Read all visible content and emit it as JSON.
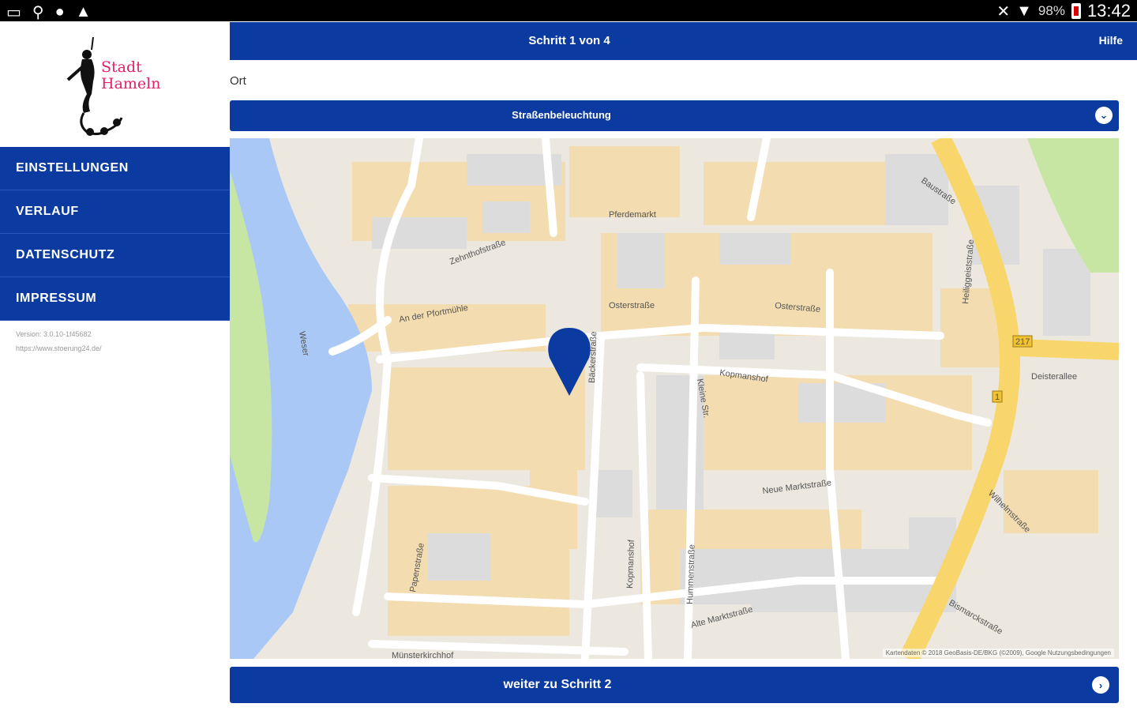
{
  "status_bar": {
    "battery_percent": "98%",
    "time": "13:42"
  },
  "sidebar": {
    "logo": {
      "line1": "Stadt",
      "line2": "Hameln"
    },
    "menu": [
      {
        "label": "EINSTELLUNGEN"
      },
      {
        "label": "VERLAUF"
      },
      {
        "label": "DATENSCHUTZ"
      },
      {
        "label": "IMPRESSUM"
      }
    ],
    "version": "Version: 3.0.10-1f45682",
    "website": "https://www.stoerung24.de/"
  },
  "header": {
    "step": "Schritt 1 von 4",
    "help": "Hilfe"
  },
  "form": {
    "location_label": "Ort",
    "category_value": "Straßenbeleuchtung"
  },
  "map": {
    "street_labels": {
      "pferdemarkt": "Pferdemarkt",
      "osterstrasse": "Osterstraße",
      "osterstrasse_short": "Osterstraße",
      "kopmanshof": "Kopmanshof",
      "neue_marktstrasse": "Neue Marktstraße",
      "alte_marktstrasse": "Alte Marktstraße",
      "deisterallee": "Deisterallee",
      "weser": "Weser",
      "an_der_pfortmuehle": "An der Pfortmühle",
      "baustrasse": "Baustraße",
      "bismarckstrasse": "Bismarckstraße",
      "wilhelmstrasse": "Wilhelmstraße",
      "papenstrasse": "Papenstraße",
      "baeckerstrasse": "Bäckerstraße",
      "muensterkirchhof": "Münsterkirchhof",
      "zehnthofstrasse": "Zehnthofstraße",
      "kleine_strasse": "Kleine Str.",
      "hummenstrasse": "Hummenstraße",
      "kopmanshof_v": "Kopmanshof",
      "heiliggeiststrasse": "Heiliggeiststraße",
      "route_217": "217",
      "route_1": "1"
    },
    "attribution": "Kartendaten © 2018 GeoBasis-DE/BKG (©2009), Google   Nutzungsbedingungen",
    "colors": {
      "water": "#a9c8f5",
      "park": "#c7e6a4",
      "block": "#f3ddb0",
      "building": "#dcdcdc",
      "road_major": "#f8d66b",
      "pin": "#0b3aa0"
    }
  },
  "footer": {
    "next_label": "weiter zu Schritt 2"
  },
  "theme": {
    "primary": "#0b3aa0",
    "brand_pink": "#e0226a"
  }
}
